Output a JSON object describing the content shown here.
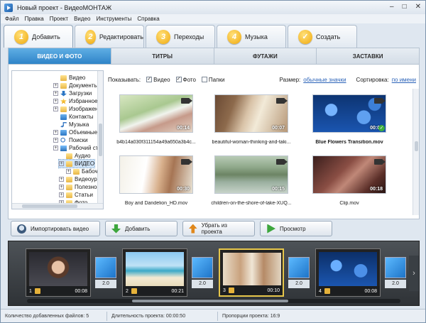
{
  "window": {
    "title": "Новый проект - ВидеоМОНТАЖ"
  },
  "menu": [
    "Файл",
    "Правка",
    "Проект",
    "Видео",
    "Инструменты",
    "Справка"
  ],
  "steps": [
    {
      "num": "1",
      "label": "Добавить"
    },
    {
      "num": "2",
      "label": "Редактировать"
    },
    {
      "num": "3",
      "label": "Переходы"
    },
    {
      "num": "4",
      "label": "Музыка"
    },
    {
      "num": "✓",
      "label": "Создать"
    }
  ],
  "main_tabs": [
    "ВИДЕО И ФОТО",
    "ТИТРЫ",
    "ФУТАЖИ",
    "ЗАСТАВКИ"
  ],
  "tree": [
    {
      "label": "Видео",
      "icon": "folder",
      "selected": false
    },
    {
      "label": "Документы",
      "icon": "folder",
      "selected": false
    },
    {
      "label": "Загрузки",
      "icon": "arrow",
      "selected": false
    },
    {
      "label": "Избранное",
      "icon": "star",
      "selected": false
    },
    {
      "label": "Изображения",
      "icon": "folder",
      "selected": false
    },
    {
      "label": "Контакты",
      "icon": "blue",
      "selected": false
    },
    {
      "label": "Музыка",
      "icon": "note",
      "selected": false
    },
    {
      "label": "Объемные",
      "icon": "blue",
      "selected": false
    },
    {
      "label": "Поиски",
      "icon": "lens",
      "selected": false
    },
    {
      "label": "Рабочий стол",
      "icon": "pc",
      "selected": false
    },
    {
      "label": "Аудио",
      "icon": "folder",
      "selected": false
    },
    {
      "label": "ВИДЕО",
      "icon": "folder",
      "selected": true
    },
    {
      "label": "Бабочки",
      "icon": "folder",
      "selected": false
    },
    {
      "label": "Видеоуроки",
      "icon": "folder",
      "selected": false
    },
    {
      "label": "Полезное",
      "icon": "folder",
      "selected": false
    },
    {
      "label": "Статьи",
      "icon": "folder",
      "selected": false
    },
    {
      "label": "Фото",
      "icon": "folder",
      "selected": false
    }
  ],
  "filter": {
    "show_label": "Показывать:",
    "video_label": "Видео",
    "video_checked": true,
    "photo_label": "Фото",
    "photo_checked": true,
    "folders_label": "Папки",
    "folders_checked": false,
    "size_label": "Размер:",
    "size_value": "обычные значки",
    "sort_label": "Сортировка:",
    "sort_value": "по имени"
  },
  "files": [
    {
      "name": "b4b14a030f311154a49a650a3b4c...",
      "duration": "00:14",
      "bold": false,
      "added": false
    },
    {
      "name": "beautiful-woman-thinking-and-taki...",
      "duration": "00:07",
      "bold": false,
      "added": false
    },
    {
      "name": "Blue Flowers Transition.mov",
      "duration": "00:08",
      "bold": true,
      "added": true
    },
    {
      "name": "Boy and Dandelion_HD.mov",
      "duration": "00:30",
      "bold": false,
      "added": false
    },
    {
      "name": "children-on-the-shore-of-lake-XUQ...",
      "duration": "00:15",
      "bold": false,
      "added": false
    },
    {
      "name": "Clip.mov",
      "duration": "00:18",
      "bold": false,
      "added": false
    }
  ],
  "actions": {
    "import": "Импортировать видео",
    "add": "Добавить",
    "remove": "Убрать из проекта",
    "preview": "Просмотр"
  },
  "timeline": {
    "clips": [
      {
        "num": "1",
        "duration": "00:08",
        "active": false
      },
      {
        "num": "2",
        "duration": "00:21",
        "active": false
      },
      {
        "num": "3",
        "duration": "00:10",
        "active": true
      },
      {
        "num": "4",
        "duration": "00:08",
        "active": false
      }
    ],
    "transitions": [
      "2.0",
      "2.0",
      "2.0",
      "2.0"
    ]
  },
  "status": {
    "files_added": "Количество добавленных файлов: 5",
    "duration": "Длительность проекта: 00:00:50",
    "ratio": "Пропорции проекта: 16:9"
  },
  "colors": {
    "accent": "#2f84c8",
    "step_badge": "#f0a80b",
    "active_clip": "#e6c64a"
  }
}
